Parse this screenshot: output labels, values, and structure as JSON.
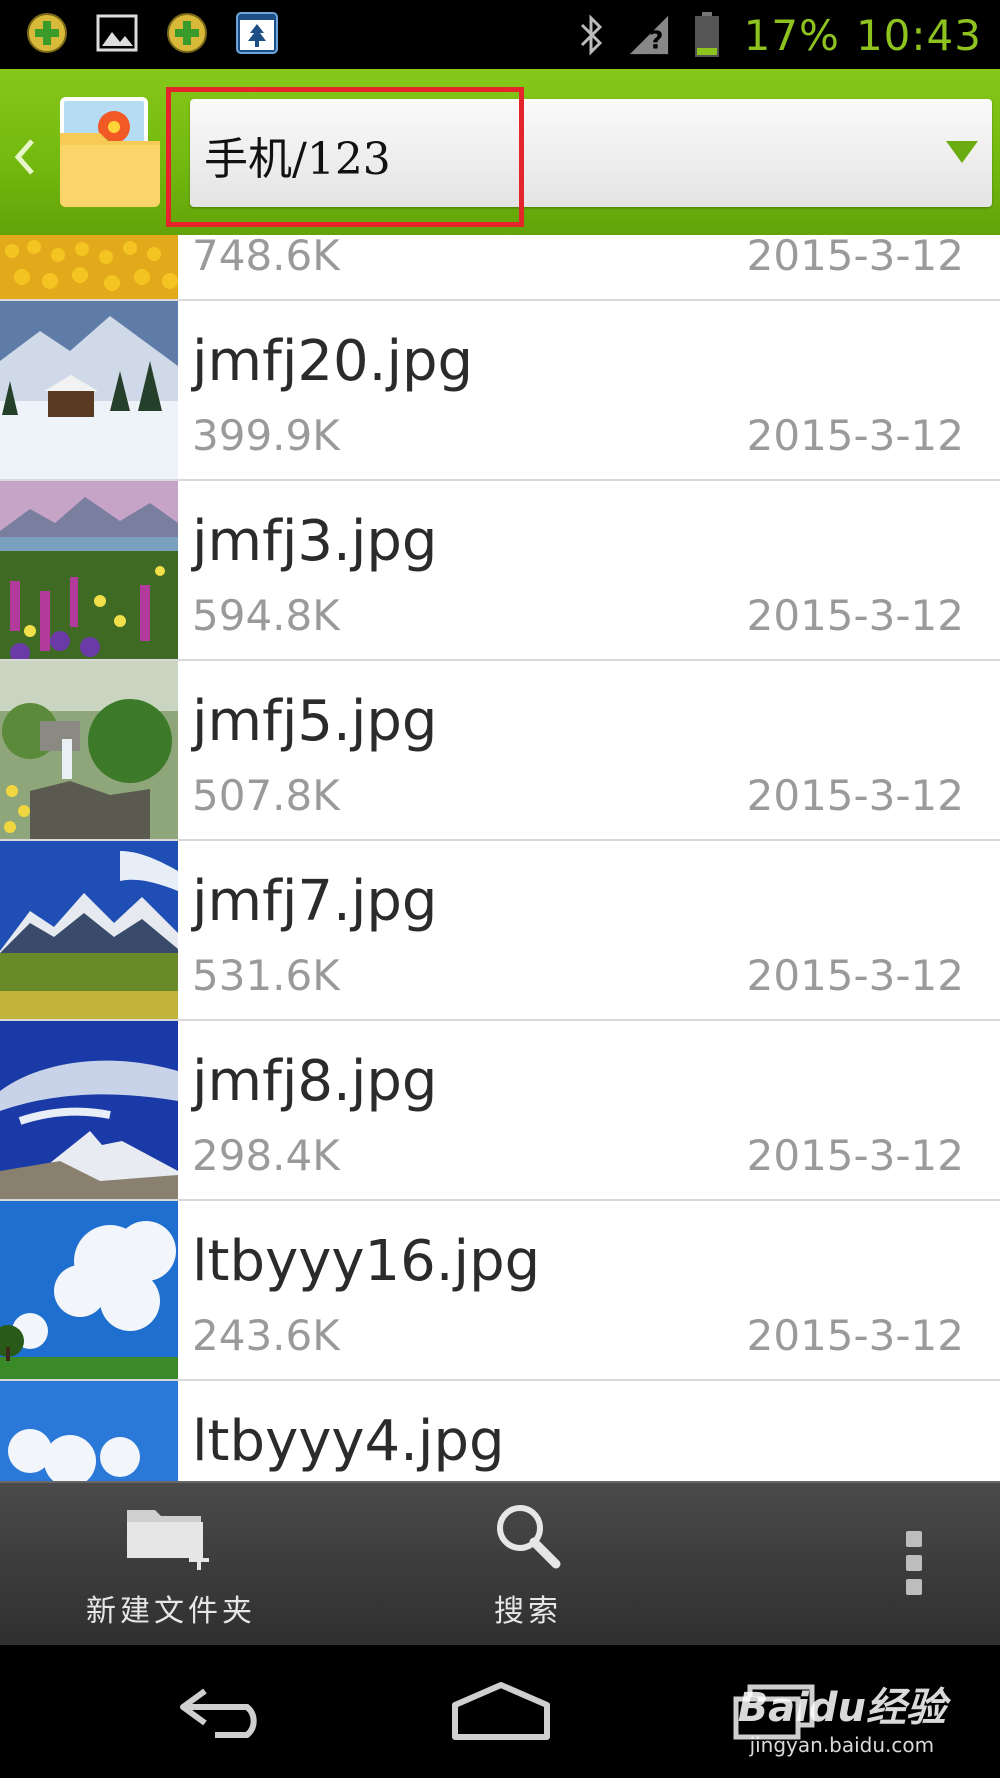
{
  "status_bar": {
    "battery": "17%",
    "time": "10:43",
    "icons": [
      "app-plus-icon",
      "gallery-icon",
      "app-plus-icon",
      "tree-app-icon",
      "bluetooth-icon",
      "no-signal-icon",
      "battery-icon"
    ]
  },
  "header": {
    "path": "手机/123",
    "icons": [
      "back-chevron-icon",
      "photo-folder-icon",
      "dropdown-arrow-icon"
    ]
  },
  "files": [
    {
      "name": "",
      "size": "748.6K",
      "date": "2015-3-12",
      "thumb": "sunflowers"
    },
    {
      "name": "jmfj20.jpg",
      "size": "399.9K",
      "date": "2015-3-12",
      "thumb": "snow-cabin"
    },
    {
      "name": "jmfj3.jpg",
      "size": "594.8K",
      "date": "2015-3-12",
      "thumb": "flower-field-mountains"
    },
    {
      "name": "jmfj5.jpg",
      "size": "507.8K",
      "date": "2015-3-12",
      "thumb": "waterfall-stream"
    },
    {
      "name": "jmfj7.jpg",
      "size": "531.6K",
      "date": "2015-3-12",
      "thumb": "alps-meadow"
    },
    {
      "name": "jmfj8.jpg",
      "size": "298.4K",
      "date": "2015-3-12",
      "thumb": "matterhorn-clouds"
    },
    {
      "name": "ltbyyy16.jpg",
      "size": "243.6K",
      "date": "2015-3-12",
      "thumb": "blue-sky-clouds"
    },
    {
      "name": "ltbyyy4.jpg",
      "size": "",
      "date": "",
      "thumb": "sky-clouds"
    }
  ],
  "toolbar": {
    "new_folder_label": "新建文件夹",
    "search_label": "搜索"
  },
  "watermark": {
    "main": "Baidu经验",
    "sub": "jingyan.baidu.com"
  },
  "colors": {
    "header_green": "#74b90f",
    "status_green": "#8dc21f",
    "highlight_red": "#e4262c",
    "toolbar_bg": "#3a3a3a"
  }
}
